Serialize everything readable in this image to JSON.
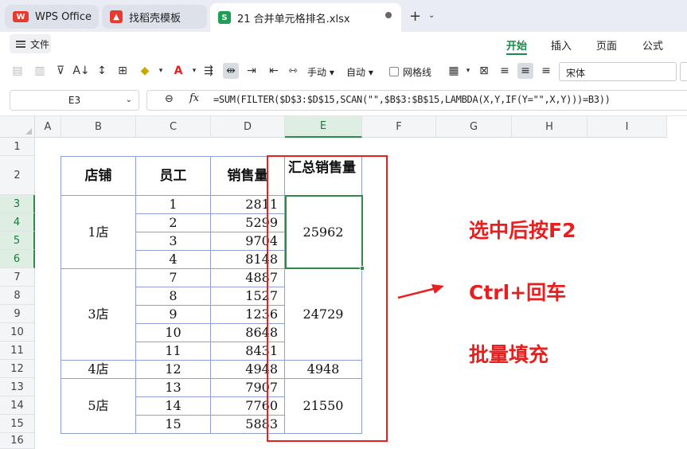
{
  "tabs": {
    "wps": {
      "icon": "wps-logo-icon",
      "label": "WPS Office"
    },
    "template": {
      "icon": "docer-logo-icon",
      "label": "找稻壳模板"
    },
    "file": {
      "icon": "S",
      "label": "21 合并单元格排名.xlsx"
    }
  },
  "menu": {
    "file": "文件",
    "ribbon_tabs": [
      "开始",
      "插入",
      "页面",
      "公式"
    ]
  },
  "toolbar": {
    "manual_label": "手动",
    "auto_label": "自动",
    "gridlines_label": "网格线",
    "gridlines_checked": false,
    "font_name": "宋体"
  },
  "formula_bar": {
    "cell_ref": "E3",
    "fx": "fx",
    "formula": "=SUM(FILTER($D$3:$D$15,SCAN(\"\",$B$3:$B$15,LAMBDA(X,Y,IF(Y=\"\",X,Y)))=B3))"
  },
  "columns": [
    "A",
    "B",
    "C",
    "D",
    "E",
    "F",
    "G",
    "H",
    "I"
  ],
  "selected_column": "E",
  "rows": [
    "1",
    "2",
    "3",
    "4",
    "5",
    "6",
    "7",
    "8",
    "9",
    "10",
    "11",
    "12",
    "13",
    "14",
    "15",
    "16"
  ],
  "selected_rows": [
    "3",
    "4",
    "5",
    "6"
  ],
  "table": {
    "headers": [
      "店铺",
      "员工",
      "销售量",
      "汇总销售量"
    ],
    "groups": [
      {
        "store": "1店",
        "employees": [
          "1",
          "2",
          "3",
          "4"
        ],
        "sales": [
          "2811",
          "5299",
          "9704",
          "8148"
        ],
        "total": "25962"
      },
      {
        "store": "3店",
        "employees": [
          "7",
          "8",
          "9",
          "10",
          "11"
        ],
        "sales": [
          "4887",
          "1527",
          "1236",
          "8648",
          "8431"
        ],
        "total": "24729"
      },
      {
        "store": "4店",
        "employees": [
          "12"
        ],
        "sales": [
          "4948"
        ],
        "total": "4948"
      },
      {
        "store": "5店",
        "employees": [
          "13",
          "14",
          "15"
        ],
        "sales": [
          "7907",
          "7760",
          "5883"
        ],
        "total": "21550"
      }
    ]
  },
  "annotations": {
    "line1": "选中后按F2",
    "line2": "Ctrl+回车",
    "line3": "批量填充",
    "color": "#e81f1f"
  },
  "colors": {
    "accent": "#1a8a4a",
    "selection": "#2e8a4a",
    "table_border": "#8ea0d6"
  }
}
